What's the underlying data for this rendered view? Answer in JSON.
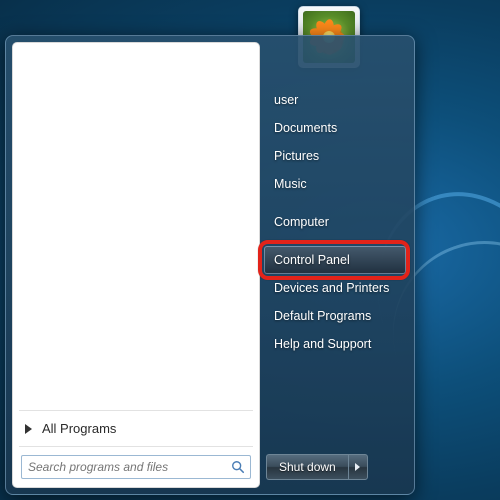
{
  "left": {
    "all_programs_label": "All Programs",
    "search_placeholder": "Search programs and files"
  },
  "right": {
    "items": [
      {
        "label": "user"
      },
      {
        "label": "Documents"
      },
      {
        "label": "Pictures"
      },
      {
        "label": "Music"
      }
    ],
    "items2": [
      {
        "label": "Computer"
      }
    ],
    "items3": [
      {
        "label": "Control Panel",
        "highlighted": true,
        "hovered": true
      },
      {
        "label": "Devices and Printers"
      },
      {
        "label": "Default Programs"
      },
      {
        "label": "Help and Support"
      }
    ]
  },
  "shutdown": {
    "label": "Shut down"
  },
  "highlight": {
    "color": "#e2231a"
  }
}
